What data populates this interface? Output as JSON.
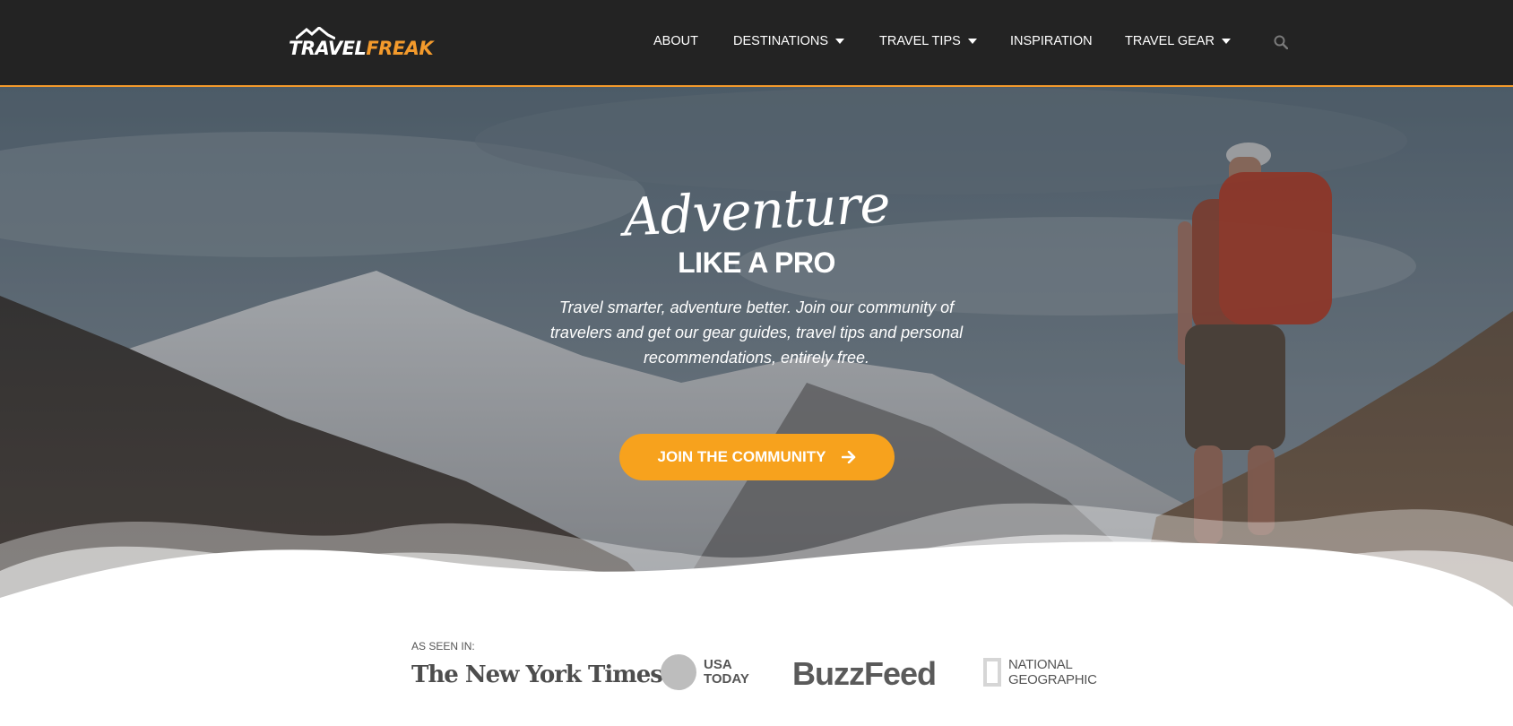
{
  "header": {
    "logo": {
      "part1": "TRAVEL",
      "part2": "FREAK"
    },
    "nav": [
      {
        "label": "ABOUT",
        "dropdown": false
      },
      {
        "label": "DESTINATIONS",
        "dropdown": true
      },
      {
        "label": "TRAVEL TIPS",
        "dropdown": true
      },
      {
        "label": "INSPIRATION",
        "dropdown": false
      },
      {
        "label": "TRAVEL GEAR",
        "dropdown": true
      }
    ],
    "search_icon": "search-icon"
  },
  "hero": {
    "title_script": "Adventure",
    "title_sub": "LIKE A PRO",
    "description": "Travel smarter, adventure better. Join our community of travelers and get our gear guides, travel tips and personal recommendations, entirely free.",
    "cta_label": "JOIN THE COMMUNITY",
    "cta_icon": "arrow-right-icon"
  },
  "press": {
    "label": "AS SEEN IN:",
    "nyt": "The New York Times",
    "usa_line1": "USA",
    "usa_line2": "TODAY",
    "buzzfeed": "BuzzFeed",
    "natgeo_line1": "NATIONAL",
    "natgeo_line2": "GEOGRAPHIC"
  },
  "colors": {
    "header_bg": "#232323",
    "accent": "#f39a2c",
    "cta_bg": "#f7a21d"
  }
}
